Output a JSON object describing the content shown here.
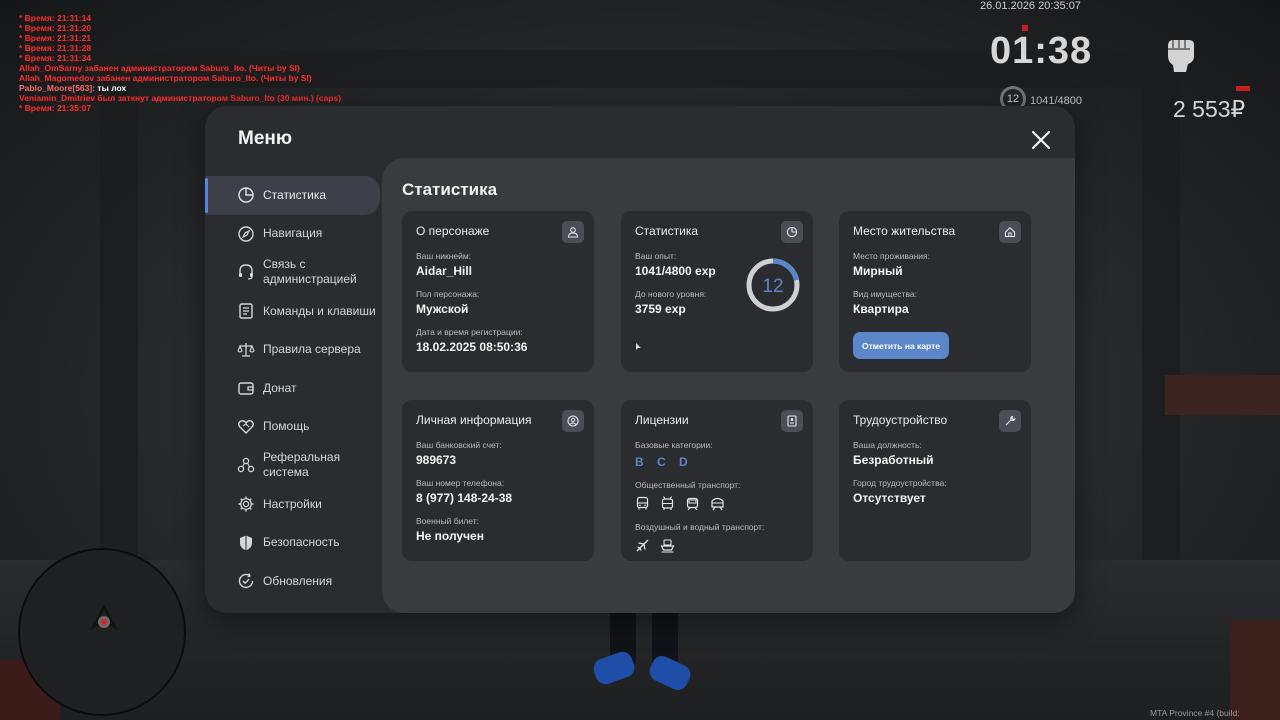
{
  "chat": [
    {
      "text": "* Время: 21:31:14",
      "color": "red"
    },
    {
      "text": "* Время: 21:31:20",
      "color": "red"
    },
    {
      "text": "* Время: 21:31:21",
      "color": "red"
    },
    {
      "text": "* Время: 21:31:28",
      "color": "red"
    },
    {
      "text": "* Время: 21:31:34",
      "color": "red"
    },
    {
      "text": "Allah_OmSarny забанен администратором Saburo_Ito. (Читы by SI)",
      "color": "red"
    },
    {
      "text": "Allah_Magomedov забанен администратором Saburo_Ito. (Читы by SI)",
      "color": "red"
    },
    {
      "text": "Pablo_Moore[563]:",
      "color": "pink",
      "extra": " ты лох"
    },
    {
      "text": "Veniamin_Dmitriev был заткнут администратором Saburo_Ito (30 мин.) (caps)",
      "color": "red"
    },
    {
      "text": "* Время: 21:35:07",
      "color": "red"
    }
  ],
  "hud": {
    "date": "26.01.2026 20:35:07",
    "time": "01:38",
    "level": "12",
    "exp": "1041/4800",
    "money": "2 553₽"
  },
  "build": "MTA Province #4 (build: 6.12422.9)",
  "menu": {
    "title": "Меню",
    "nav": [
      {
        "label": "Статистика",
        "icon": "pie-chart-icon",
        "active": true
      },
      {
        "label": "Навигация",
        "icon": "compass-icon"
      },
      {
        "label": "Связь с администрацией",
        "icon": "headset-icon"
      },
      {
        "label": "Команды и клавиши",
        "icon": "document-icon"
      },
      {
        "label": "Правила сервера",
        "icon": "scales-icon"
      },
      {
        "label": "Донат",
        "icon": "wallet-icon"
      },
      {
        "label": "Помощь",
        "icon": "heart-handshake-icon"
      },
      {
        "label": "Реферальная система",
        "icon": "referral-icon"
      },
      {
        "label": "Настройки",
        "icon": "gear-icon"
      },
      {
        "label": "Безопасность",
        "icon": "shield-icon"
      },
      {
        "label": "Обновления",
        "icon": "refresh-check-icon"
      }
    ],
    "content_title": "Статистика",
    "cards": {
      "person": {
        "title": "О персонаже",
        "nick_label": "Ваш никнейм:",
        "nick": "Aidar_Hill",
        "gender_label": "Пол персонажа:",
        "gender": "Мужской",
        "reg_label": "Дата и время регистрации:",
        "reg": "18.02.2025 08:50:36"
      },
      "stats": {
        "title": "Статистика",
        "exp_label": "Ваш опыт:",
        "exp": "1041/4800 exp",
        "next_label": "До нового уровня:",
        "next": "3759 exp",
        "level": "12",
        "progress": 0.217
      },
      "home": {
        "title": "Место жительства",
        "place_label": "Место проживания:",
        "place": "Мирный",
        "prop_label": "Вид имущества:",
        "prop": "Квартира",
        "button": "Отметить на карте"
      },
      "personal": {
        "title": "Личная информация",
        "bank_label": "Ваш банковский счет:",
        "bank": "989673",
        "phone_label": "Ваш номер телефона:",
        "phone": "8 (977) 148-24-38",
        "military_label": "Военный билет:",
        "military": "Не получен"
      },
      "licenses": {
        "title": "Лицензии",
        "base_label": "Базовые категории:",
        "base": "B C D",
        "public_label": "Общественный транспорт:",
        "air_label": "Воздушный и водный транспорт:"
      },
      "job": {
        "title": "Трудоустройство",
        "post_label": "Ваша должность:",
        "post": "Безработный",
        "city_label": "Город трудоустройства:",
        "city": "Отсутствует"
      }
    }
  },
  "colors": {
    "accent": "#5b86c9",
    "panel": "#2b2c2f",
    "content": "#3a3b3e"
  }
}
